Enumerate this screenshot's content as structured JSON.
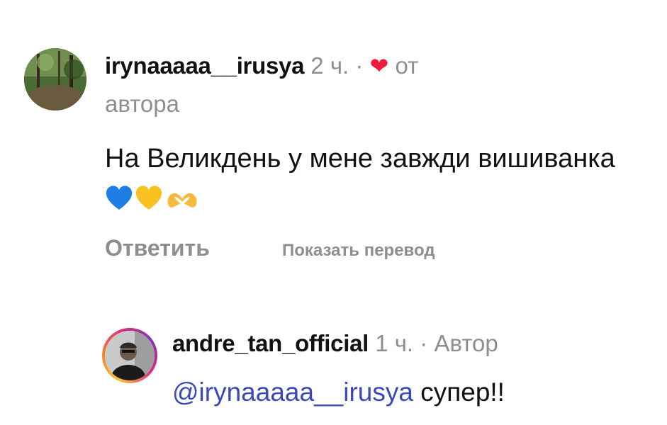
{
  "comment": {
    "username": "irynaaaaa__irusya",
    "time": "2 ч.",
    "separator": "·",
    "liked_by_author_prefix": "от",
    "liked_by_author_suffix": "автора",
    "text": "На Великдень у мене завжди вишиванка",
    "emojis": [
      "blue-heart-icon",
      "yellow-heart-icon",
      "heart-hands-icon"
    ],
    "reply_label": "Ответить",
    "translate_label": "Показать перевод",
    "heart_color": "#ED1C3A"
  },
  "reply": {
    "username": "andre_tan_official",
    "time": "1 ч.",
    "separator": "·",
    "role": "Автор",
    "mention": "@irynaaaaa__irusya",
    "text": "супер!!",
    "mention_color": "#3B49B8"
  }
}
